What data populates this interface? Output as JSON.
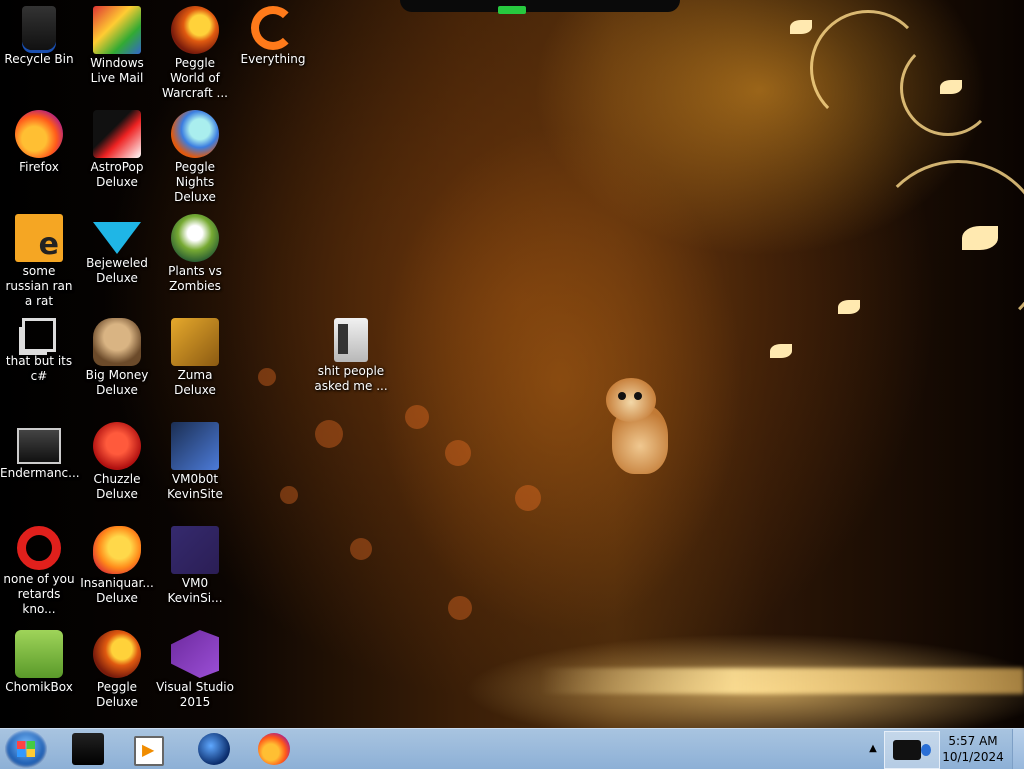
{
  "desktop": {
    "icons": [
      {
        "label": "Recycle Bin",
        "icon": "recycle-bin-icon"
      },
      {
        "label": "Windows Live Mail",
        "icon": "windows-live-mail-icon"
      },
      {
        "label": "Peggle World of Warcraft ...",
        "icon": "peggle-icon"
      },
      {
        "label": "Everything",
        "icon": "everything-search-icon"
      },
      {
        "label": "Firefox",
        "icon": "firefox-icon"
      },
      {
        "label": "AstroPop Deluxe",
        "icon": "astropop-icon"
      },
      {
        "label": "Peggle Nights Deluxe",
        "icon": "peggle-nights-icon"
      },
      {
        "label": "some russian ran a rat",
        "icon": "html-file-icon"
      },
      {
        "label": "Bejeweled Deluxe",
        "icon": "bejeweled-icon"
      },
      {
        "label": "Plants vs Zombies",
        "icon": "plants-vs-zombies-icon"
      },
      {
        "label": "that but its c#",
        "icon": "shortcut-copy-icon"
      },
      {
        "label": "Big Money Deluxe",
        "icon": "big-money-icon"
      },
      {
        "label": "Zuma Deluxe",
        "icon": "zuma-icon"
      },
      {
        "label": "shit people asked me ...",
        "icon": "folder-icon"
      },
      {
        "label": "Endermanc...",
        "icon": "endermanch-icon"
      },
      {
        "label": "Chuzzle Deluxe",
        "icon": "chuzzle-icon"
      },
      {
        "label": "VM0b0t KevinSite",
        "icon": "vm-site-icon"
      },
      {
        "label": "none of you retards kno...",
        "icon": "opera-icon"
      },
      {
        "label": "Insaniquar... Deluxe",
        "icon": "insaniquarium-icon"
      },
      {
        "label": "VM0 KevinSi...",
        "icon": "vm-site-icon"
      },
      {
        "label": "ChomikBox",
        "icon": "chomikbox-icon"
      },
      {
        "label": "Peggle Deluxe",
        "icon": "peggle-icon"
      },
      {
        "label": "Visual Studio 2015",
        "icon": "visual-studio-icon"
      }
    ]
  },
  "taskbar": {
    "pinned": [
      {
        "icon": "dark-app-icon"
      },
      {
        "icon": "media-player-icon"
      },
      {
        "icon": "globe-browser-icon"
      },
      {
        "icon": "firefox-icon"
      }
    ],
    "tray_arrow": "▲",
    "clock": {
      "time": "5:57 AM",
      "date": "10/1/2024"
    }
  }
}
